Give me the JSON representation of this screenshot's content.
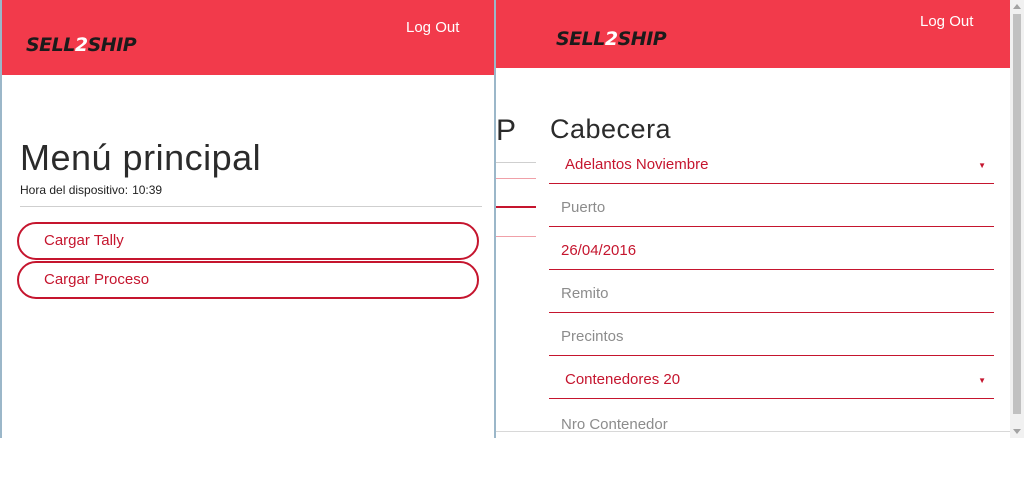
{
  "left": {
    "brand": {
      "part1": "SELL",
      "part2": "2",
      "part3": "SHIP"
    },
    "logout_label": "Log Out",
    "title": "Menú principal",
    "device_time_label": "Hora del dispositivo:",
    "device_time_value": "10:39",
    "buttons": [
      {
        "label": "Cargar Tally"
      },
      {
        "label": "Cargar Proceso"
      }
    ]
  },
  "right": {
    "brand": {
      "part1": "SELL",
      "part2": "2",
      "part3": "SHIP"
    },
    "logout_label": "Log Out",
    "ghost_glyph": "P",
    "title": "Cabecera",
    "fields": {
      "cabecera_select": {
        "value": "Adelantos Noviembre"
      },
      "puerto": {
        "placeholder": "Puerto"
      },
      "fecha": {
        "value": "26/04/2016"
      },
      "remito": {
        "placeholder": "Remito"
      },
      "precintos": {
        "placeholder": "Precintos"
      },
      "contenedores_select": {
        "value": "Contenedores 20"
      },
      "nro_contenedor": {
        "placeholder": "Nro Contenedor"
      }
    },
    "caret_glyph": "▼"
  },
  "colors": {
    "header_red": "#f23a4b",
    "accent_red": "#c5152e",
    "logo_dark": "#1b1b1b"
  }
}
